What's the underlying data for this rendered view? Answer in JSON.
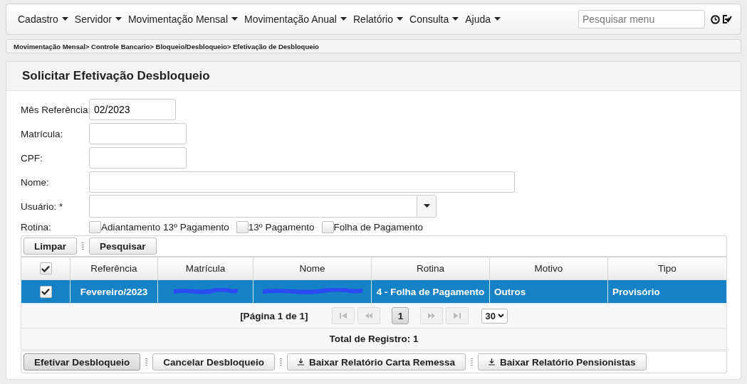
{
  "menu": {
    "items": [
      "Cadastro",
      "Servidor",
      "Movimentação Mensal",
      "Movimentação Anual",
      "Relatório",
      "Consulta",
      "Ajuda"
    ],
    "search": {
      "placeholder": "Pesquisar menu"
    }
  },
  "breadcrumb": "Movimentação Mensal> Controle Bancario> Bloqueio/Desbloqueio> Efetivação de Desbloqueio",
  "title": "Solicitar Efetivação Desbloqueio",
  "form": {
    "fields": [
      {
        "label": "Mês Referência:",
        "value": "02/2023",
        "kind": "short"
      },
      {
        "label": "Matrícula:",
        "kind": "medium"
      },
      {
        "label": "CPF:",
        "kind": "medium"
      },
      {
        "label": "Nome:",
        "kind": "long"
      },
      {
        "label": "Usuário: *",
        "kind": "combo"
      }
    ],
    "rotina": {
      "label": "Rotina:",
      "options": [
        {
          "label": "Adiantamento 13º Pagamento",
          "checked": false
        },
        {
          "label": "13º Pagamento",
          "checked": false
        },
        {
          "label": "Folha de Pagamento",
          "checked": false
        }
      ]
    }
  },
  "toolbar": [
    "Limpar",
    "Pesquisar"
  ],
  "table": {
    "all_checked": true,
    "columns": [
      "Referência",
      "Matrícula",
      "Nome",
      "Rotina",
      "Motivo",
      "Tipo"
    ],
    "rows": [
      {
        "selected": true,
        "checked": true,
        "cells": [
          {
            "kind": "text",
            "text": "Fevereiro/2023"
          },
          {
            "kind": "redacted"
          },
          {
            "kind": "redacted"
          },
          {
            "kind": "text",
            "text": "4 - Folha de Pagamento"
          },
          {
            "kind": "text",
            "text": "Outros"
          },
          {
            "kind": "text",
            "text": "Provisório"
          }
        ]
      }
    ],
    "pager": {
      "info": "[Página 1 de 1]",
      "page": "1",
      "page_size": "30"
    },
    "total": "Total de Registro: 1"
  },
  "actions": [
    {
      "label": "Efetivar Desbloqueio",
      "kind": "plain",
      "selected": true
    },
    {
      "label": "Cancelar Desbloqueio",
      "kind": "plain",
      "selected": false
    },
    {
      "label": "Baixar Relatório Carta Remessa",
      "kind": "download",
      "selected": false
    },
    {
      "label": "Baixar Relatório Pensionistas",
      "kind": "download",
      "selected": false
    }
  ]
}
